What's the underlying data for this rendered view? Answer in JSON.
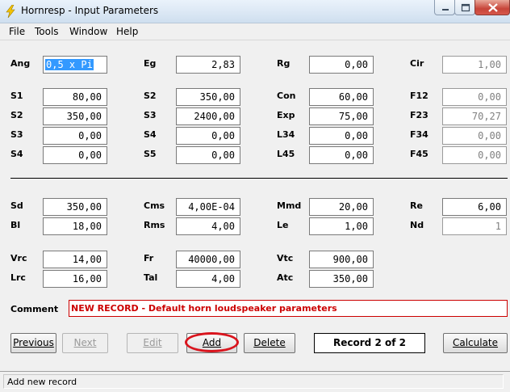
{
  "window": {
    "title": "Hornresp - Input Parameters"
  },
  "menu": [
    "File",
    "Tools",
    "Window",
    "Help"
  ],
  "row_ang": [
    {
      "label": "Ang",
      "value": "0,5 x Pi"
    },
    {
      "label": "Eg",
      "value": "2,83"
    },
    {
      "label": "Rg",
      "value": "0,00"
    },
    {
      "label": "Cir",
      "value": "1,00"
    }
  ],
  "rows_horn": [
    [
      {
        "label": "S1",
        "value": "80,00"
      },
      {
        "label": "S2",
        "value": "350,00"
      },
      {
        "label": "Con",
        "value": "60,00"
      },
      {
        "label": "F12",
        "value": "0,00"
      }
    ],
    [
      {
        "label": "S2",
        "value": "350,00"
      },
      {
        "label": "S3",
        "value": "2400,00"
      },
      {
        "label": "Exp",
        "value": "75,00"
      },
      {
        "label": "F23",
        "value": "70,27"
      }
    ],
    [
      {
        "label": "S3",
        "value": "0,00"
      },
      {
        "label": "S4",
        "value": "0,00"
      },
      {
        "label": "L34",
        "value": "0,00"
      },
      {
        "label": "F34",
        "value": "0,00"
      }
    ],
    [
      {
        "label": "S4",
        "value": "0,00"
      },
      {
        "label": "S5",
        "value": "0,00"
      },
      {
        "label": "L45",
        "value": "0,00"
      },
      {
        "label": "F45",
        "value": "0,00"
      }
    ]
  ],
  "rows_driver": [
    [
      {
        "label": "Sd",
        "value": "350,00"
      },
      {
        "label": "Cms",
        "value": "4,00E-04"
      },
      {
        "label": "Mmd",
        "value": "20,00"
      },
      {
        "label": "Re",
        "value": "6,00"
      }
    ],
    [
      {
        "label": "Bl",
        "value": "18,00"
      },
      {
        "label": "Rms",
        "value": "4,00"
      },
      {
        "label": "Le",
        "value": "1,00"
      },
      {
        "label": "Nd",
        "value": "1"
      }
    ]
  ],
  "rows_chamber": [
    [
      {
        "label": "Vrc",
        "value": "14,00"
      },
      {
        "label": "Fr",
        "value": "40000,00"
      },
      {
        "label": "Vtc",
        "value": "900,00"
      }
    ],
    [
      {
        "label": "Lrc",
        "value": "16,00"
      },
      {
        "label": "Tal",
        "value": "4,00"
      },
      {
        "label": "Atc",
        "value": "350,00"
      }
    ]
  ],
  "comment": {
    "label": "Comment",
    "value": "NEW RECORD - Default horn loudspeaker parameters"
  },
  "buttons": {
    "previous": "Previous",
    "next": "Next",
    "edit": "Edit",
    "add": "Add",
    "delete": "Delete",
    "calculate": "Calculate"
  },
  "record_indicator": "Record 2 of 2",
  "status": "Add new record",
  "colors": {
    "comment_text": "#cc0000",
    "highlight_oval": "#d9141d",
    "selection": "#3399ff"
  }
}
